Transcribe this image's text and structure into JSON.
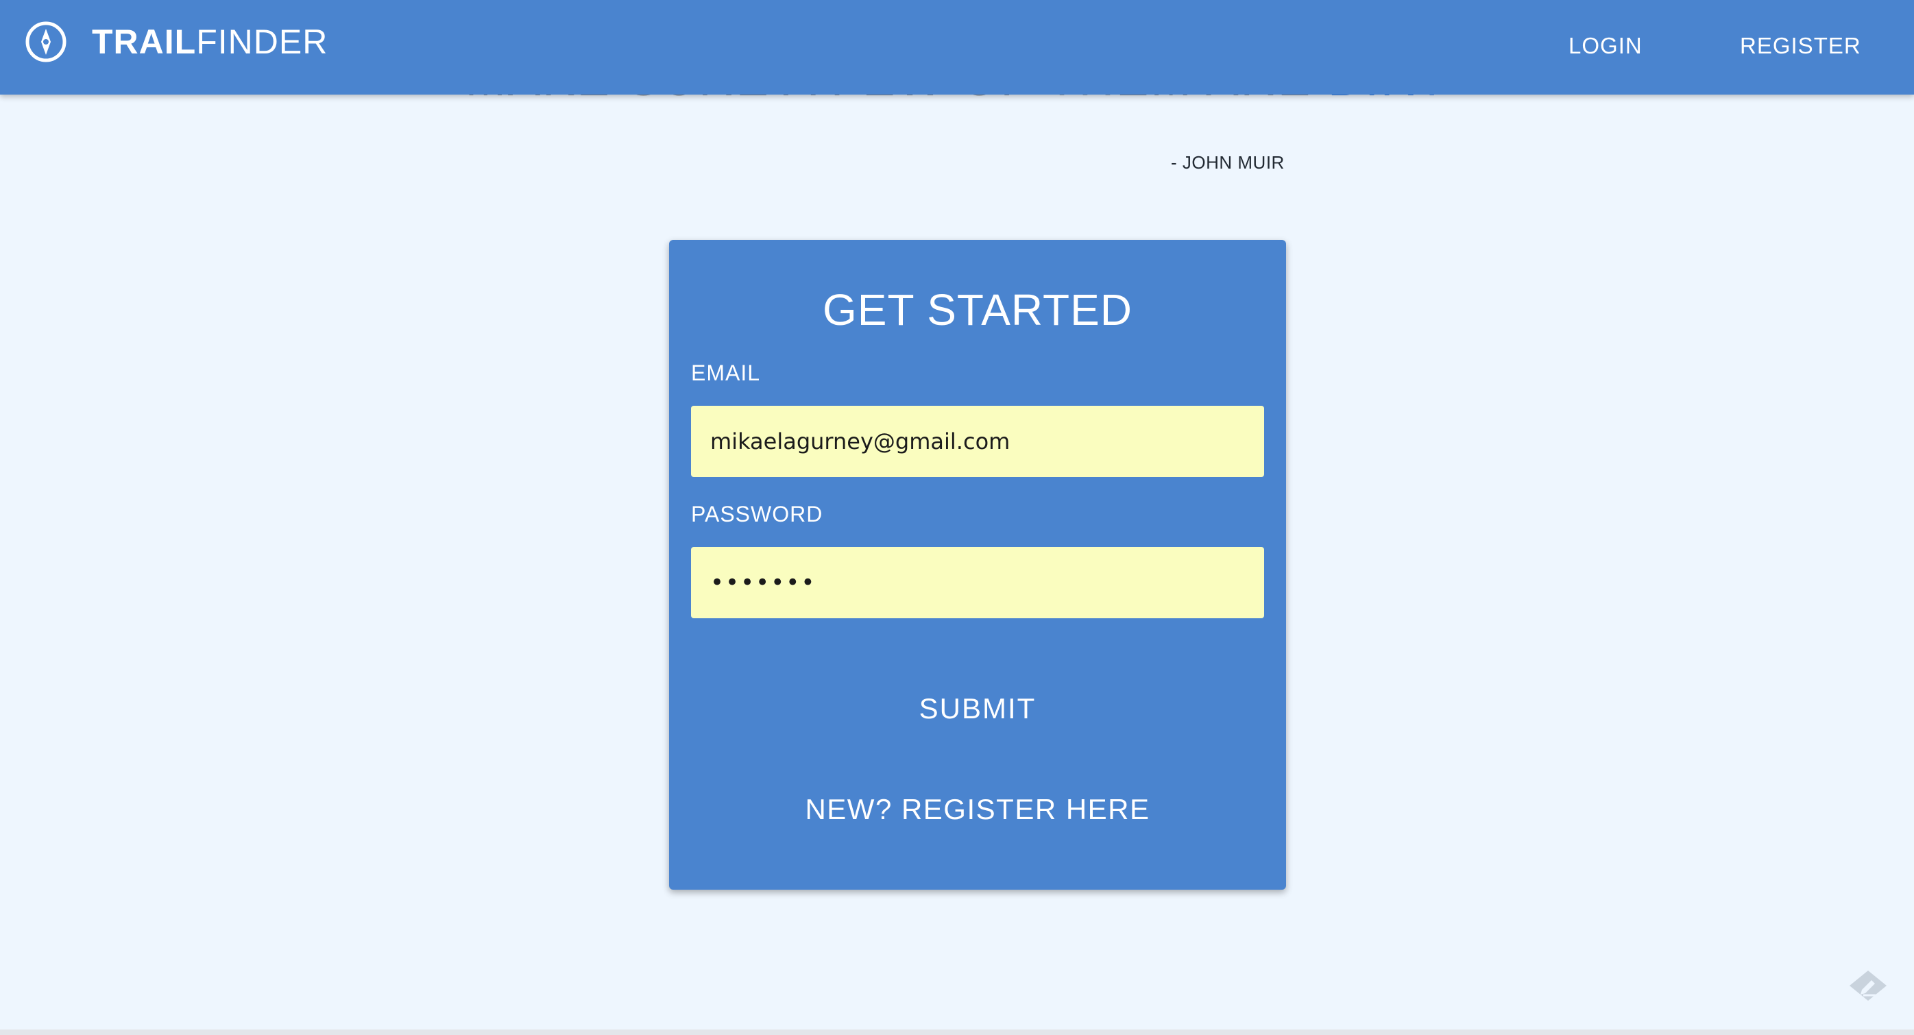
{
  "header": {
    "brand_bold": "TRAIL",
    "brand_light": "FINDER",
    "logo_icon": "compass-icon",
    "nav": {
      "login": "LOGIN",
      "register": "REGISTER"
    }
  },
  "quote": {
    "text": "MAKE SURE A FEW OF THEM ARE ",
    "accent": "DIRT",
    "attribution": "- JOHN MUIR"
  },
  "form": {
    "title": "GET STARTED",
    "email_label": "EMAIL",
    "email_value": "mikaelagurney@gmail.com",
    "password_label": "PASSWORD",
    "password_value": "•••••••",
    "submit_label": "SUBMIT",
    "register_link": "NEW? REGISTER HERE"
  },
  "widgets": {
    "feedback_icon": "feedback-pencil-icon"
  },
  "colors": {
    "header_bg": "#4a84cf",
    "card_bg": "#4a84cf",
    "page_bg": "#eef6fe",
    "input_bg": "#fafdbf",
    "quote_accent": "#3c7fe0"
  }
}
